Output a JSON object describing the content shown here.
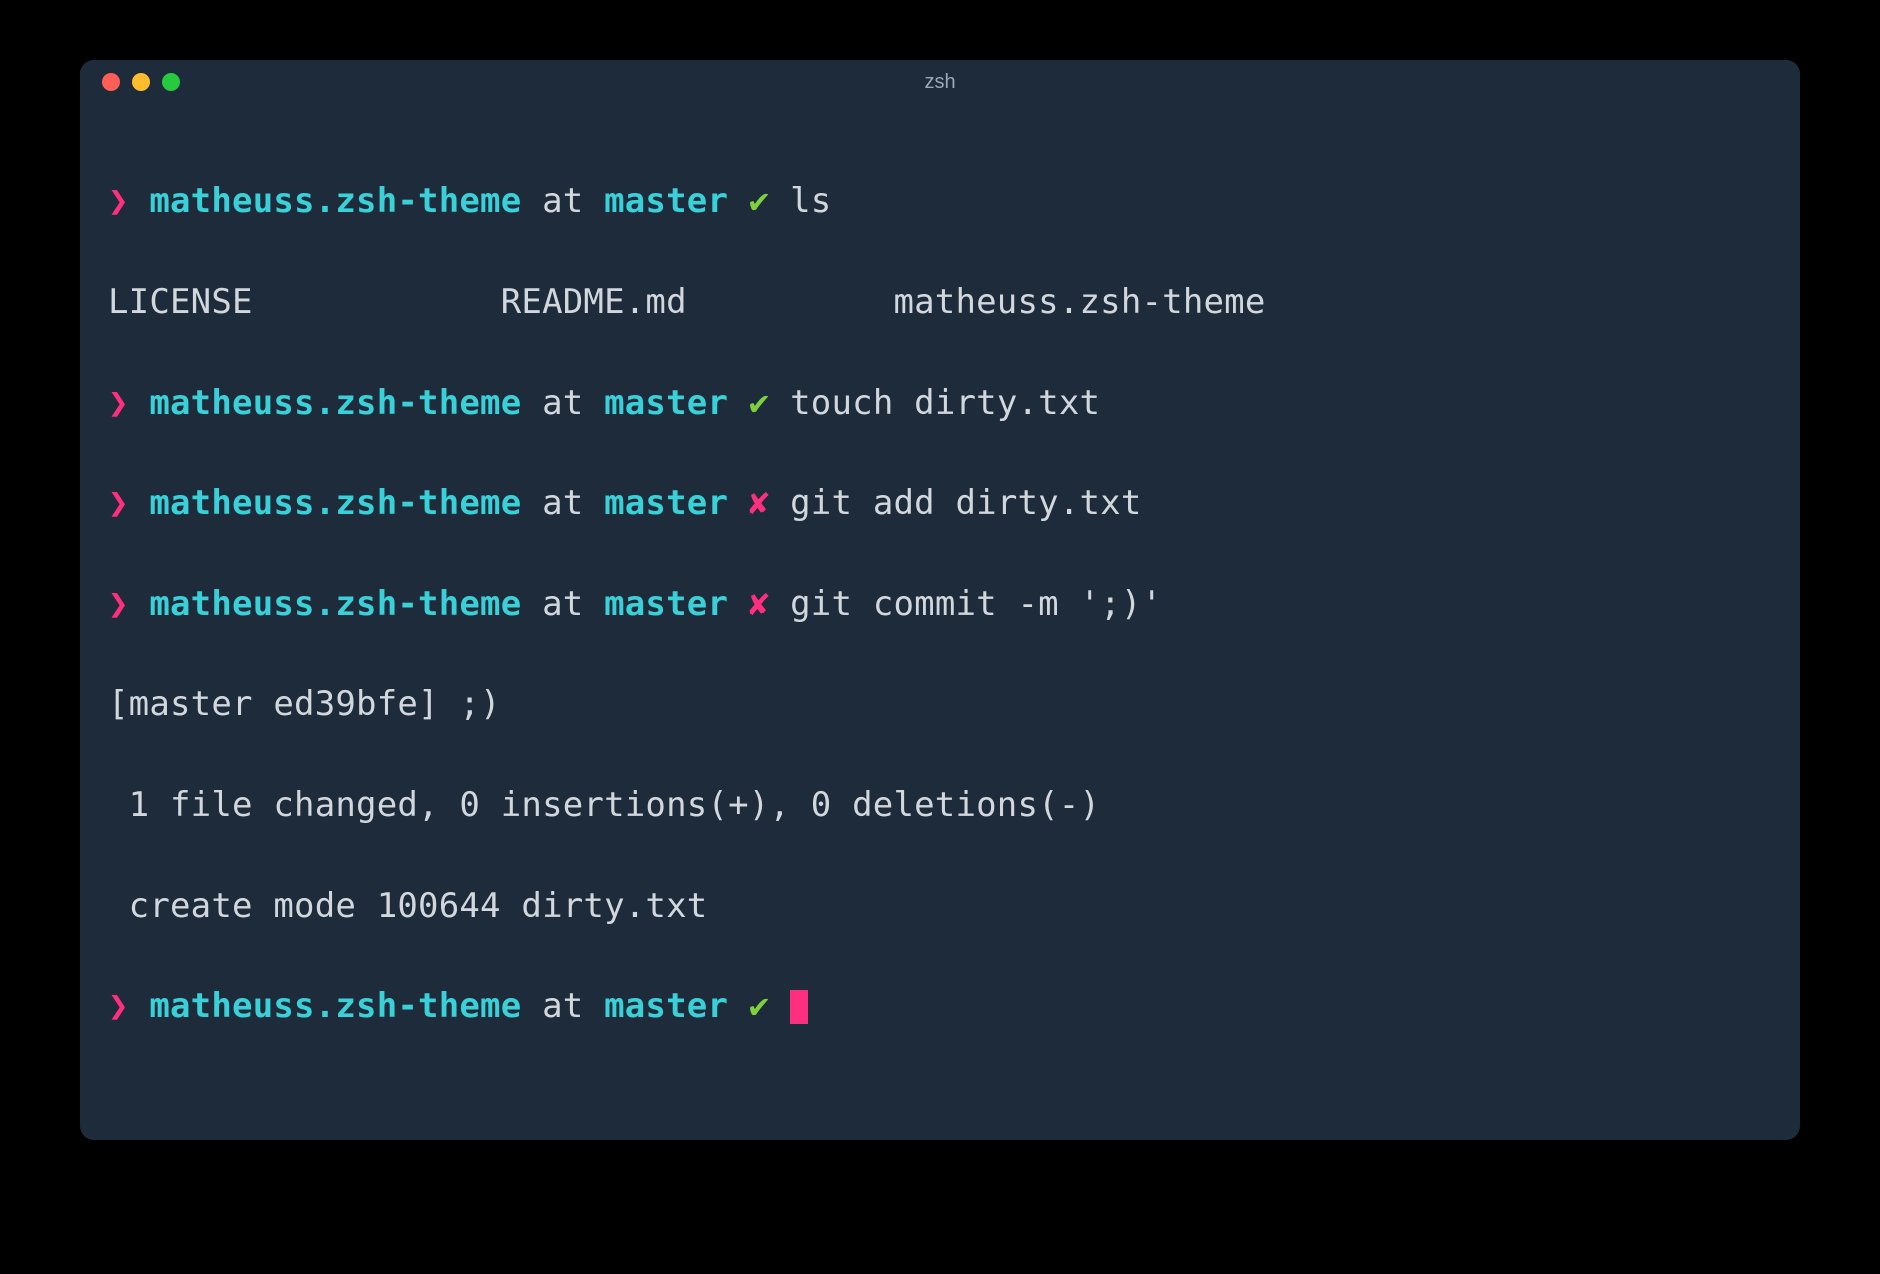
{
  "window": {
    "title": "zsh"
  },
  "prompt": {
    "chevron": "❯",
    "dir": "matheuss.zsh-theme",
    "at": "at",
    "branch": "master",
    "clean_icon": "✔",
    "dirty_icon": "✘"
  },
  "lines": {
    "l1_cmd": "ls",
    "l2_output": "LICENSE            README.md          matheuss.zsh-theme",
    "l3_cmd": "touch dirty.txt",
    "l4_cmd": "git add dirty.txt",
    "l5_cmd": "git commit -m ';)'",
    "l6_output": "[master ed39bfe] ;)",
    "l7_output": " 1 file changed, 0 insertions(+), 0 deletions(-)",
    "l8_output": " create mode 100644 dirty.txt"
  }
}
